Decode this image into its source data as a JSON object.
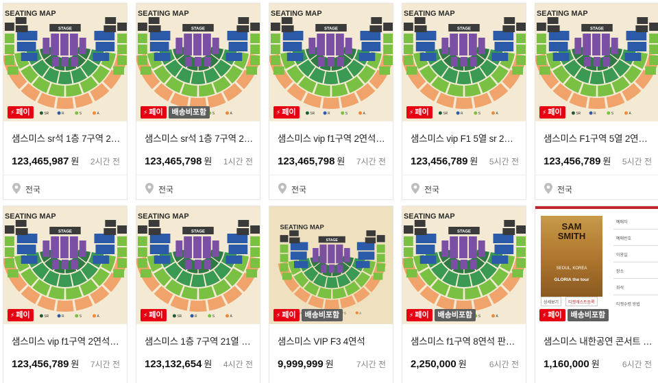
{
  "seating_map": {
    "heading": "SEATING MAP",
    "stage": "STAGE",
    "legend": [
      "VIP",
      "SR",
      "R",
      "S",
      "A"
    ],
    "legend_colors": [
      "#7b4fa3",
      "#1d5a3a",
      "#2b5aa8",
      "#7ac143",
      "#f0883a"
    ]
  },
  "labels": {
    "pay_badge": "페이",
    "ship_badge": "배송비포함",
    "currency": "원"
  },
  "items": [
    {
      "title": "샘스미스 sr석 1층 7구역 21...",
      "price": "123,465,987",
      "ago": "2시간 전",
      "location": "전국",
      "thumb": "map",
      "ship": false
    },
    {
      "title": "샘스미스 sr석 1층 7구역 21...",
      "price": "123,465,798",
      "ago": "1시간 전",
      "location": "전국",
      "thumb": "map",
      "ship": true
    },
    {
      "title": "샘스미스 vip f1구역 2연석 양...",
      "price": "123,465,798",
      "ago": "7시간 전",
      "location": "전국",
      "thumb": "map",
      "ship": false
    },
    {
      "title": "샘스미스 vip F1 5열 sr 2연석...",
      "price": "123,456,789",
      "ago": "5시간 전",
      "location": "전국",
      "thumb": "map",
      "ship": false
    },
    {
      "title": "샘스미스 F1구역 5열 2연석 7...",
      "price": "123,456,789",
      "ago": "5시간 전",
      "location": "전국",
      "thumb": "map",
      "ship": false
    },
    {
      "title": "샘스미스 vip f1구역 2연석 양...",
      "price": "123,456,789",
      "ago": "7시간 전",
      "location": "",
      "thumb": "map",
      "ship": false
    },
    {
      "title": "샘스미스 1층 7구역 21열 2연...",
      "price": "123,132,654",
      "ago": "4시간 전",
      "location": "",
      "thumb": "map",
      "ship": false
    },
    {
      "title": "샘스미스 VIP F3 4연석",
      "price": "9,999,999",
      "ago": "7시간 전",
      "location": "",
      "thumb": "map-small",
      "ship": true
    },
    {
      "title": "샘스미스 f1구역 8연석 판매...",
      "price": "2,250,000",
      "ago": "6시간 전",
      "location": "",
      "thumb": "map",
      "ship": true
    },
    {
      "title": "샘스미스 내한공연 콘서트 4...",
      "price": "1,160,000",
      "ago": "6시간 전",
      "location": "",
      "thumb": "poster",
      "ship": true
    }
  ],
  "poster": {
    "artist_line1": "SAM",
    "artist_line2": "SMITH",
    "city": "SEOUL, KOREA",
    "tour": "GLORIA the tour",
    "side_rows": [
      "예매자",
      "예매번호",
      "이용일",
      "장소",
      "좌석"
    ],
    "btn1": "상세보기",
    "btn2": "티켓캐스트등록",
    "footer": "티켓수령 방법"
  }
}
